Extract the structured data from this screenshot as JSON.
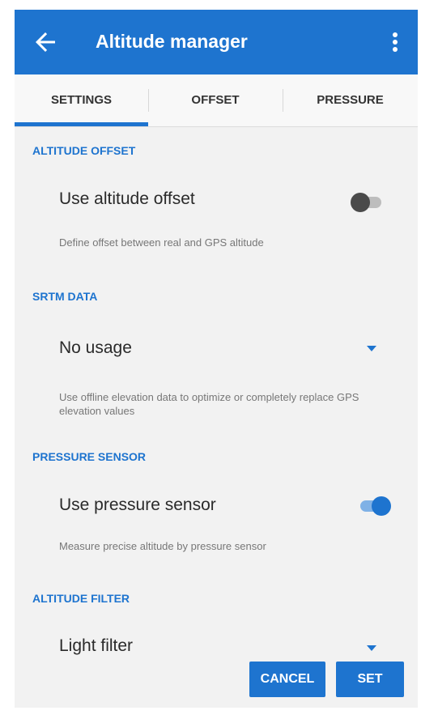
{
  "app_bar": {
    "title": "Altitude manager",
    "back_icon": "arrow-left-icon",
    "menu_icon": "more-vert-icon",
    "color": "#1e74cf"
  },
  "tabs": [
    {
      "label": "SETTINGS",
      "active": true
    },
    {
      "label": "OFFSET",
      "active": false
    },
    {
      "label": "PRESSURE",
      "active": false
    }
  ],
  "sections": {
    "altitude_offset": {
      "header": "ALTITUDE OFFSET",
      "title": "Use altitude offset",
      "summary": "Define offset between real and GPS altitude",
      "enabled": false
    },
    "srtm_data": {
      "header": "SRTM DATA",
      "value": "No usage",
      "summary": "Use offline elevation data to optimize or completely replace GPS elevation values"
    },
    "pressure_sensor": {
      "header": "PRESSURE SENSOR",
      "title": "Use pressure sensor",
      "summary": "Measure precise altitude by pressure sensor",
      "enabled": true
    },
    "altitude_filter": {
      "header": "ALTITUDE FILTER",
      "value": "Light filter"
    }
  },
  "buttons": {
    "cancel": "CANCEL",
    "set": "SET"
  }
}
